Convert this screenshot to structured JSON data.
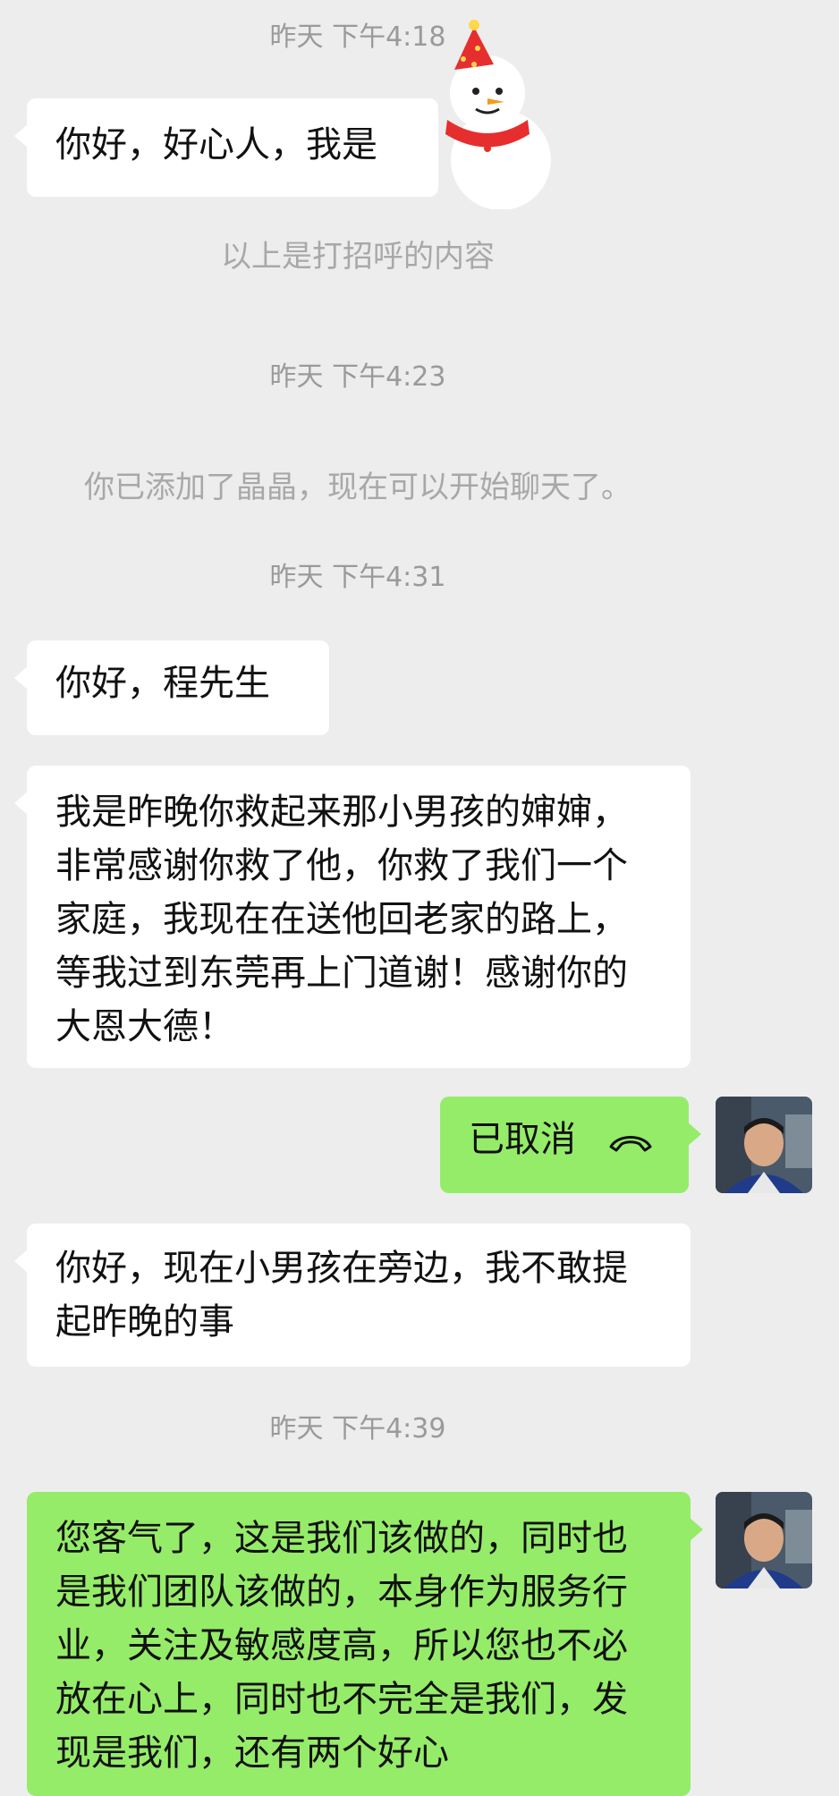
{
  "chat": {
    "ts1": "昨天 下午4:18",
    "greet": "你好，好心人，我是",
    "sys_greet": "以上是打招呼的内容",
    "ts2": "昨天 下午4:23",
    "sys_added": "你已添加了晶晶，现在可以开始聊天了。",
    "ts3": "昨天 下午4:31",
    "msg1": "你好，程先生",
    "msg2": "我是昨晚你救起来那小男孩的婶婶，非常感谢你救了他，你救了我们一个家庭，我现在在送他回老家的路上，等我过到东莞再上门道谢！感谢你的大恩大德！",
    "call_cancel": "已取消",
    "msg3": "你好，现在小男孩在旁边，我不敢提起昨晚的事",
    "ts4": "昨天 下午4:39",
    "msg4": "您客气了，这是我们该做的，同时也是我们团队该做的，本身作为服务行业，关注及敏感度高，所以您也不必放在心上，同时也不完全是我们，发现是我们，还有两个好心"
  },
  "icons": {
    "phone": "phone-hangup-icon",
    "snowman": "snowman-sticker-icon"
  },
  "colors": {
    "background": "#ededed",
    "incoming": "#ffffff",
    "outgoing": "#95ec69",
    "timestamp": "#9a9a9a"
  }
}
